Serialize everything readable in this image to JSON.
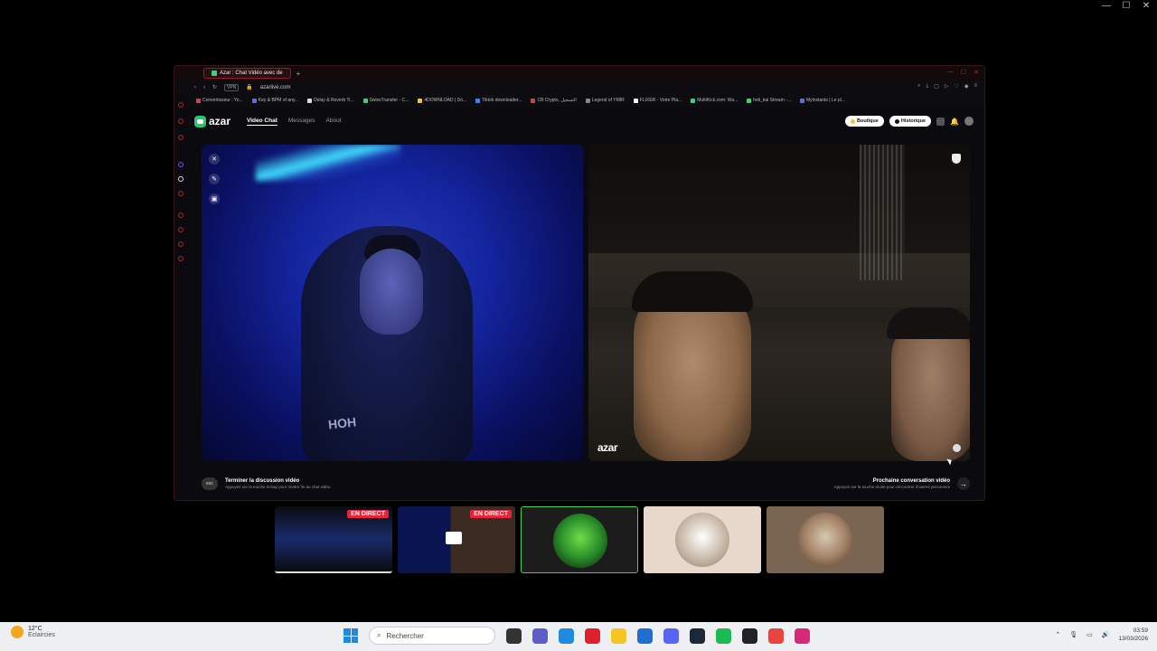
{
  "window": {
    "minimize": "—",
    "maximize": "☐",
    "close": "✕"
  },
  "browser": {
    "tab_title": "Azar : Chat Vidéo avec de",
    "new_tab": "+",
    "url": "azarlive.com",
    "vpn": "VPN",
    "bookmarks": [
      {
        "label": "Convertisseur : Yo...",
        "color": "#e23b45"
      },
      {
        "label": "Key & BPM of any...",
        "color": "#5b6bff"
      },
      {
        "label": "Delay & Reverb Ti...",
        "color": "#dddddd"
      },
      {
        "label": "SwissTransfer - C...",
        "color": "#3ad27a"
      },
      {
        "label": "4DOWNLOAD | Do...",
        "color": "#f3c623"
      },
      {
        "label": "Tiktok downloader...",
        "color": "#3b82f6"
      },
      {
        "label": "CB Crypto, التسجيل",
        "color": "#e23b45"
      },
      {
        "label": "Legend of YMIR",
        "color": "#888888"
      },
      {
        "label": "FLIXER - Votre Pla...",
        "color": "#ffffff"
      },
      {
        "label": "MultiKick.com: Wa...",
        "color": "#3ad27a"
      },
      {
        "label": "heli_kai Stream -...",
        "color": "#3ad27a"
      },
      {
        "label": "Mylnstants | Le pl...",
        "color": "#5b6bff"
      }
    ]
  },
  "site": {
    "logo_text": "azar",
    "nav": [
      "Video Chat",
      "Messages",
      "About"
    ],
    "boutique": "Boutique",
    "historique": "Historique",
    "watermark": "azar",
    "footer_left_title": "Terminer la discussion vidéo",
    "footer_left_sub": "Appuyez sur la touche échap pour mettre fin au chat vidéo.",
    "esc_key": "esc",
    "footer_right_title": "Prochaine conversation vidéo",
    "footer_right_sub": "Appuyez sur la touche droite pour rencontrer d'autres personnes",
    "next_arrow": "→",
    "shirt_text": "HOH"
  },
  "thumbnails": [
    {
      "live": "EN DIRECT"
    },
    {
      "live": "EN DIRECT"
    },
    {},
    {},
    {}
  ],
  "taskbar": {
    "temperature": "12°C",
    "weather": "Eclaircies",
    "search_placeholder": "Rechercher",
    "time": "03:59",
    "date": "13/03/2026",
    "apps": [
      {
        "name": "task-view",
        "color": "#333333"
      },
      {
        "name": "teams",
        "color": "#5b5fc7"
      },
      {
        "name": "edge",
        "color": "#1f8ae0"
      },
      {
        "name": "opera",
        "color": "#e0202e"
      },
      {
        "name": "file-explorer",
        "color": "#f3c623"
      },
      {
        "name": "store",
        "color": "#1f6fd0"
      },
      {
        "name": "discord",
        "color": "#5865f2"
      },
      {
        "name": "steam",
        "color": "#1b2838"
      },
      {
        "name": "spotify",
        "color": "#1db954"
      },
      {
        "name": "app-extra",
        "color": "#222222"
      },
      {
        "name": "chrome",
        "color": "#e8453c"
      },
      {
        "name": "instagram",
        "color": "#d62976"
      }
    ]
  }
}
